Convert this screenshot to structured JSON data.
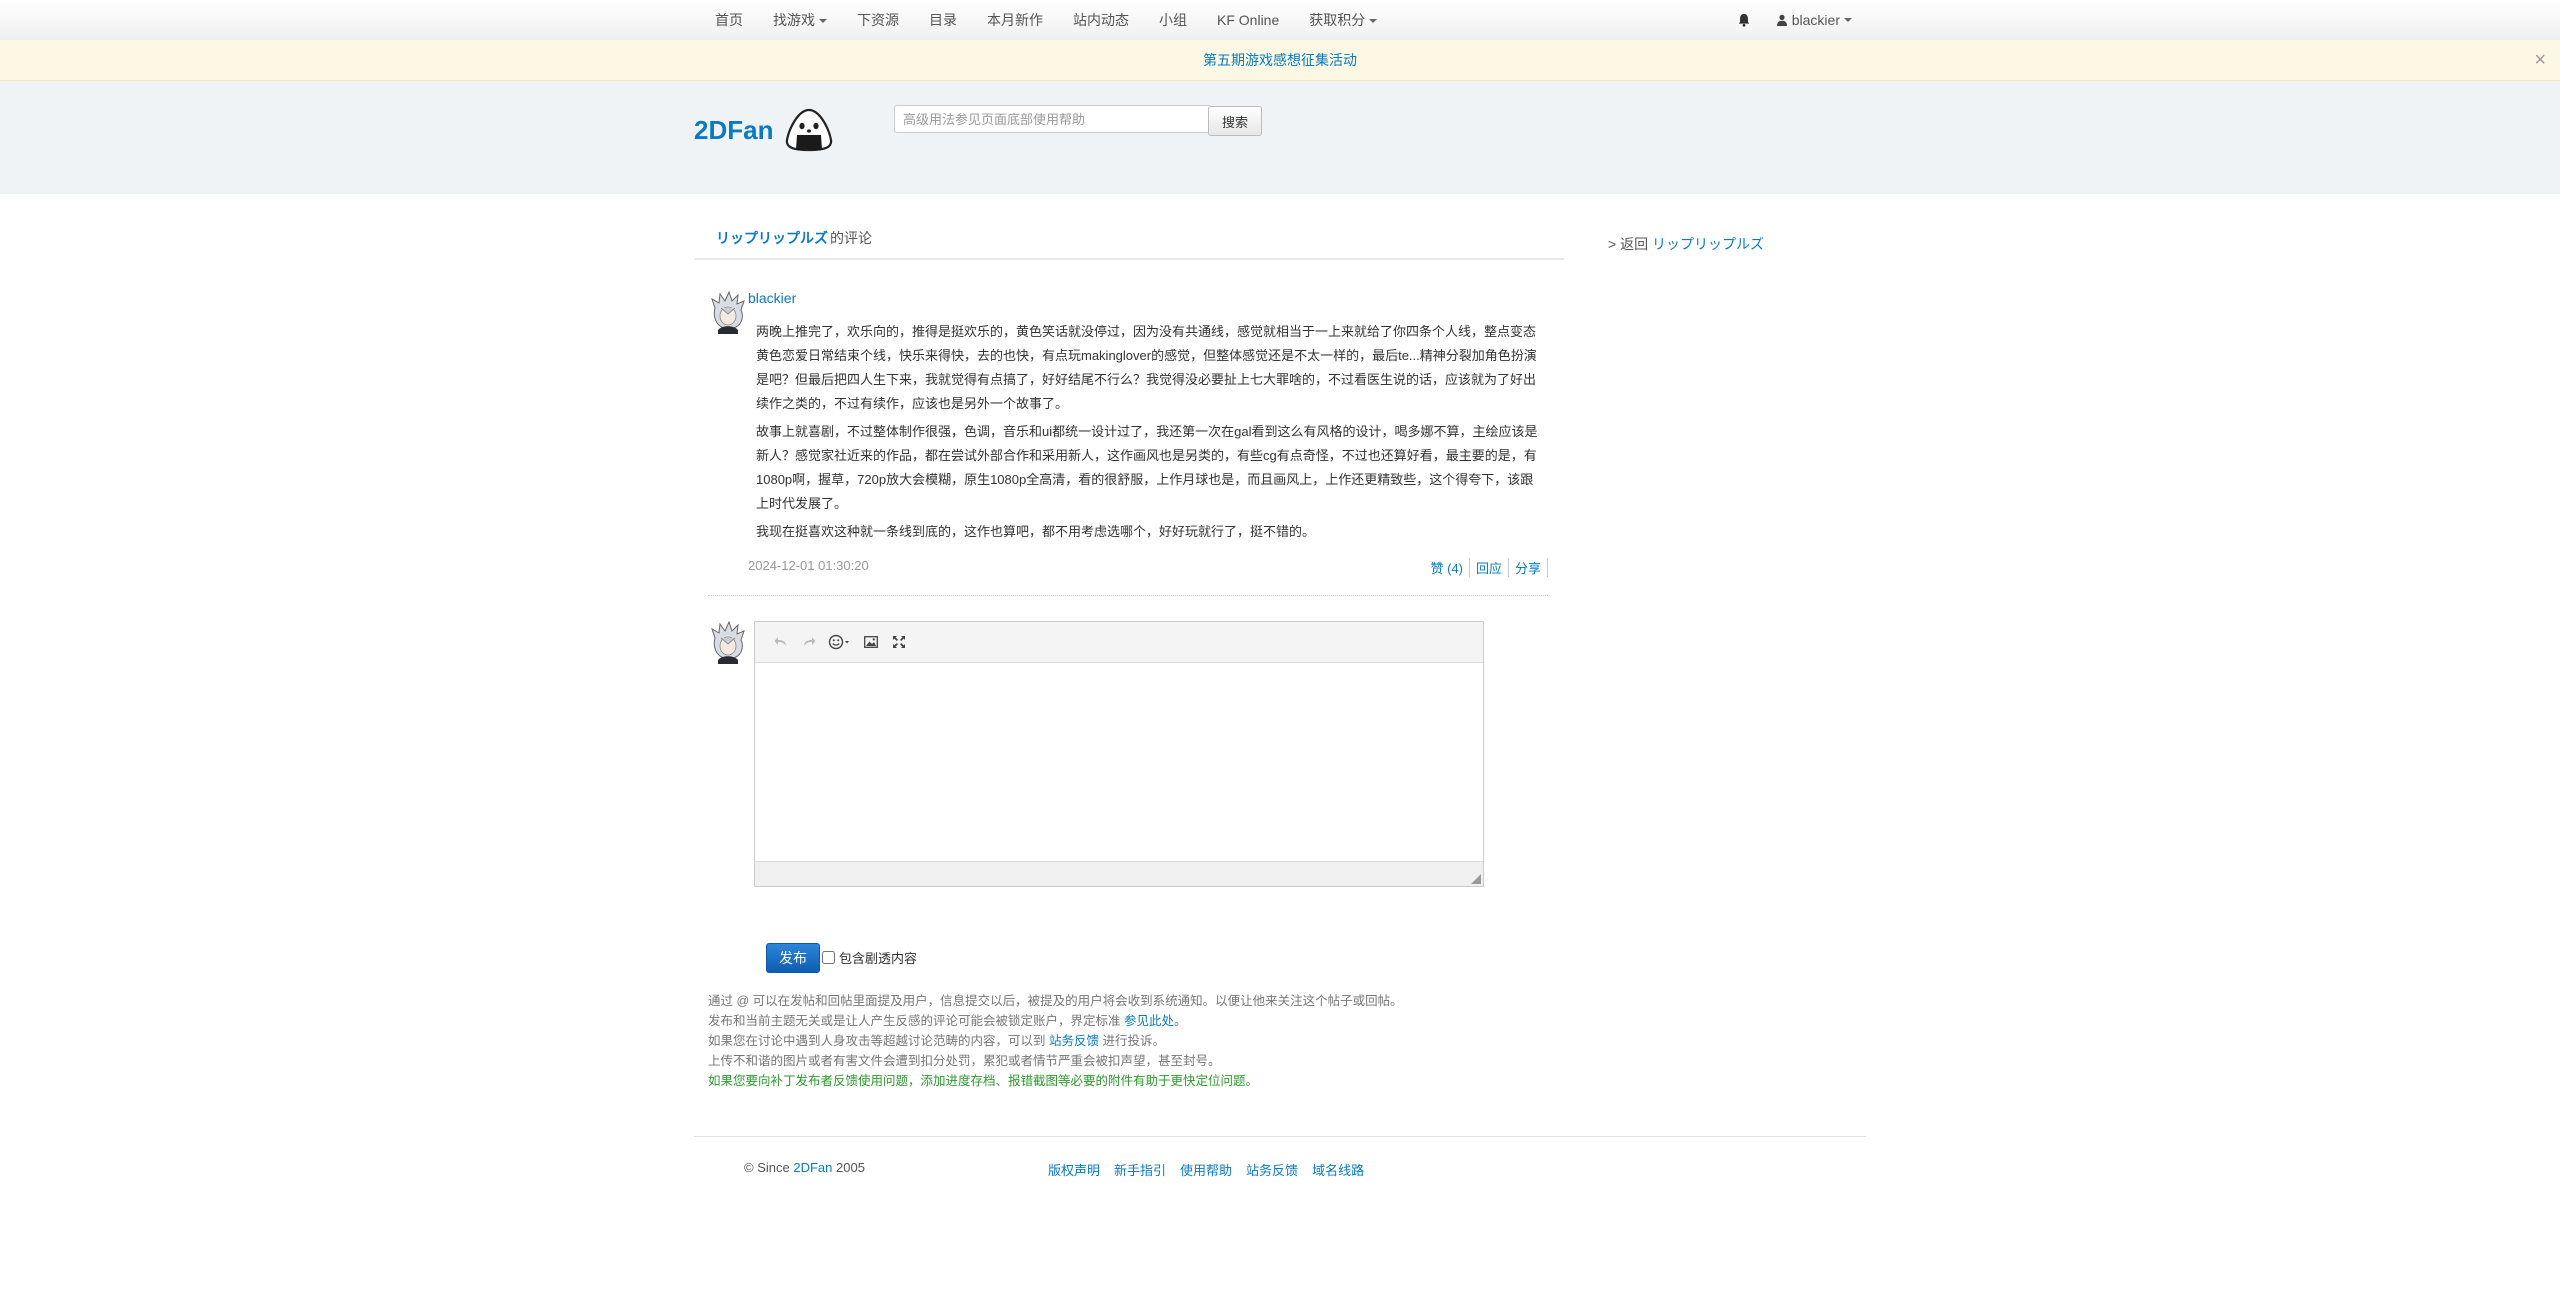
{
  "nav": {
    "items": [
      {
        "label": "首页",
        "dropdown": false
      },
      {
        "label": "找游戏",
        "dropdown": true
      },
      {
        "label": "下资源",
        "dropdown": false
      },
      {
        "label": "目录",
        "dropdown": false
      },
      {
        "label": "本月新作",
        "dropdown": false
      },
      {
        "label": "站内动态",
        "dropdown": false
      },
      {
        "label": "小组",
        "dropdown": false
      },
      {
        "label": "KF Online",
        "dropdown": false
      },
      {
        "label": "获取积分",
        "dropdown": true
      }
    ],
    "user": "blackier",
    "icons": {
      "notifications": "bell-icon",
      "user": "user-icon"
    }
  },
  "announcement": {
    "text": "第五期游戏感想征集活动",
    "close": "×"
  },
  "header": {
    "logo": "2DFan",
    "search": {
      "placeholder": "高级用法参见页面底部使用帮助",
      "value": "",
      "button": "搜索"
    }
  },
  "page": {
    "game": "リップリップルズ",
    "suffix": "的评论"
  },
  "comment": {
    "author": "blackier",
    "paragraphs": [
      "两晚上推完了，欢乐向的，推得是挺欢乐的，黄色笑话就没停过，因为没有共通线，感觉就相当于一上来就给了你四条个人线，整点变态黄色恋爱日常结束个线，快乐来得快，去的也快，有点玩makinglover的感觉，但整体感觉还是不太一样的，最后te...精神分裂加角色扮演是吧？但最后把四人生下来，我就觉得有点搞了，好好结尾不行么？我觉得没必要扯上七大罪啥的，不过看医生说的话，应该就为了好出续作之类的，不过有续作，应该也是另外一个故事了。",
      "故事上就喜剧，不过整体制作很强，色调，音乐和ui都统一设计过了，我还第一次在gal看到这么有风格的设计，喝多娜不算，主绘应该是新人？感觉家社近来的作品，都在尝试外部合作和采用新人，这作画风也是另类的，有些cg有点奇怪，不过也还算好看，最主要的是，有1080p啊，握草，720p放大会模糊，原生1080p全高清，看的很舒服，上作月球也是，而且画风上，上作还更精致些，这个得夸下，该跟上时代发展了。",
      "我现在挺喜欢这种就一条线到底的，这作也算吧，都不用考虑选哪个，好好玩就行了，挺不错的。"
    ],
    "timestamp": "2024-12-01 01:30:20",
    "actions": {
      "like": "赞 (4)",
      "reply": "回应",
      "share": "分享"
    }
  },
  "editor": {
    "toolbar": [
      "undo-icon",
      "redo-icon",
      "emoji-icon",
      "image-icon",
      "fullscreen-icon"
    ],
    "content": "",
    "publish": "发布",
    "spoiler_label": "包含剧透内容",
    "spoiler_checked": false
  },
  "notes": {
    "line1": "通过 @ 可以在发帖和回帖里面提及用户，信息提交以后，被提及的用户将会收到系统通知。以便让他来关注这个帖子或回帖。",
    "line2_text": "发布和当前主题无关或是让人产生反感的评论可能会被锁定账户，界定标准",
    "line2_link": "参见此处",
    "line2_end": "。",
    "line3_text": "如果您在讨论中遇到人身攻击等超越讨论范畴的内容，可以到",
    "line3_link": "站务反馈",
    "line3_end": "进行投诉。",
    "line4": "上传不和谐的图片或者有害文件会遭到扣分处罚，累犯或者情节严重会被扣声望，甚至封号。",
    "line5": "如果您要向补丁发布者反馈使用问题，添加进度存档、报错截图等必要的附件有助于更快定位问题。"
  },
  "sidebar": {
    "prefix": "> 返回",
    "link": "リップリップルズ"
  },
  "footer": {
    "copy_prefix": "© Since",
    "copy_link": "2DFan",
    "copy_year": "2005",
    "links": [
      "版权声明",
      "新手指引",
      "使用帮助",
      "站务反馈",
      "域名线路"
    ]
  },
  "colors": {
    "link": "#0a7bc2",
    "publish_button": "#1166c2",
    "announcement_bg": "#fcf8e3",
    "header_bg": "#f0f3f6",
    "note_green": "#2e9a2e"
  }
}
